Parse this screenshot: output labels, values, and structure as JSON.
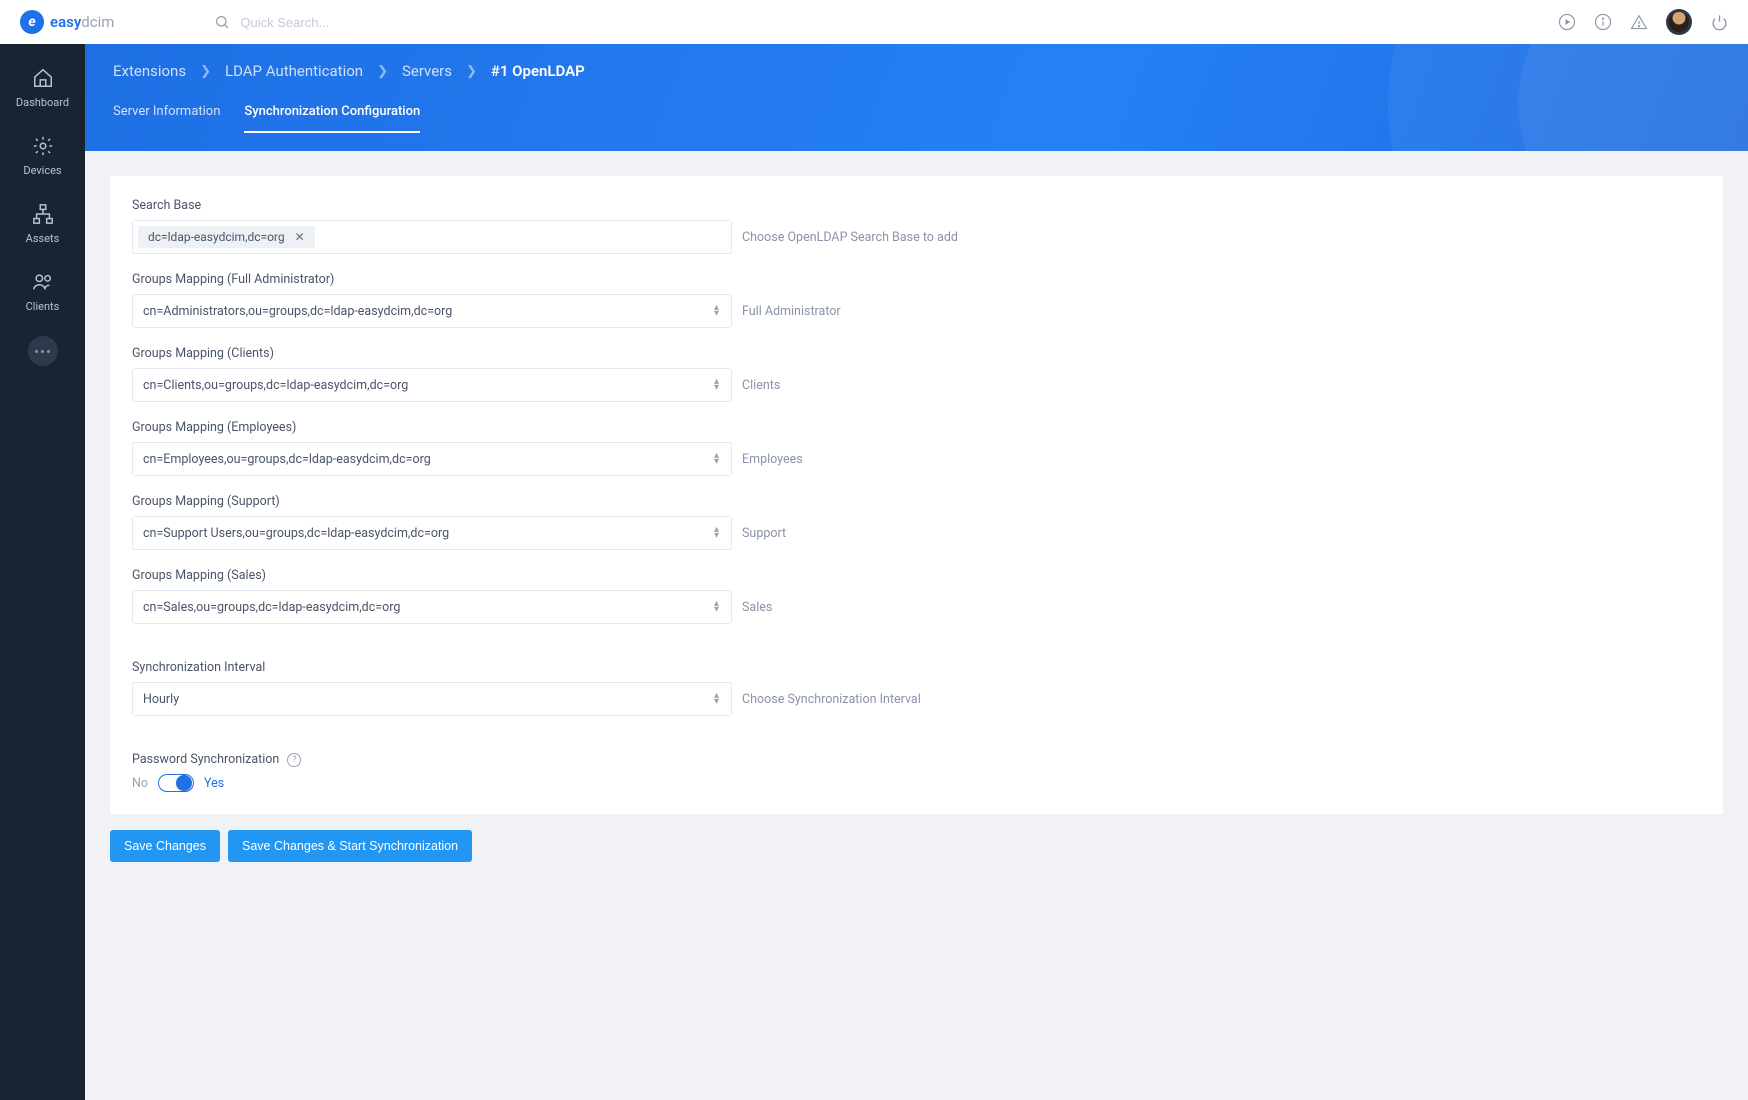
{
  "brand": {
    "main": "easy",
    "sub": "dcim"
  },
  "search": {
    "placeholder": "Quick Search..."
  },
  "sidebar": {
    "items": [
      {
        "label": "Dashboard"
      },
      {
        "label": "Devices"
      },
      {
        "label": "Assets"
      },
      {
        "label": "Clients"
      }
    ]
  },
  "breadcrumb": {
    "items": [
      "Extensions",
      "LDAP Authentication",
      "Servers",
      "#1 OpenLDAP"
    ]
  },
  "tabs": {
    "items": [
      {
        "label": "Server Information",
        "active": false
      },
      {
        "label": "Synchronization Configuration",
        "active": true
      }
    ]
  },
  "form": {
    "search_base": {
      "label": "Search Base",
      "tag": "dc=ldap-easydcim,dc=org",
      "help": "Choose OpenLDAP Search Base to add"
    },
    "groups": [
      {
        "label": "Groups Mapping (Full Administrator)",
        "value": "cn=Administrators,ou=groups,dc=ldap-easydcim,dc=org",
        "help": "Full Administrator"
      },
      {
        "label": "Groups Mapping (Clients)",
        "value": "cn=Clients,ou=groups,dc=ldap-easydcim,dc=org",
        "help": "Clients"
      },
      {
        "label": "Groups Mapping (Employees)",
        "value": "cn=Employees,ou=groups,dc=ldap-easydcim,dc=org",
        "help": "Employees"
      },
      {
        "label": "Groups Mapping (Support)",
        "value": "cn=Support Users,ou=groups,dc=ldap-easydcim,dc=org",
        "help": "Support"
      },
      {
        "label": "Groups Mapping (Sales)",
        "value": "cn=Sales,ou=groups,dc=ldap-easydcim,dc=org",
        "help": "Sales"
      }
    ],
    "interval": {
      "label": "Synchronization Interval",
      "value": "Hourly",
      "help": "Choose Synchronization Interval"
    },
    "password_sync": {
      "label": "Password Synchronization",
      "no": "No",
      "yes": "Yes",
      "value": true
    }
  },
  "buttons": {
    "save": "Save Changes",
    "save_sync": "Save Changes & Start Synchronization"
  }
}
